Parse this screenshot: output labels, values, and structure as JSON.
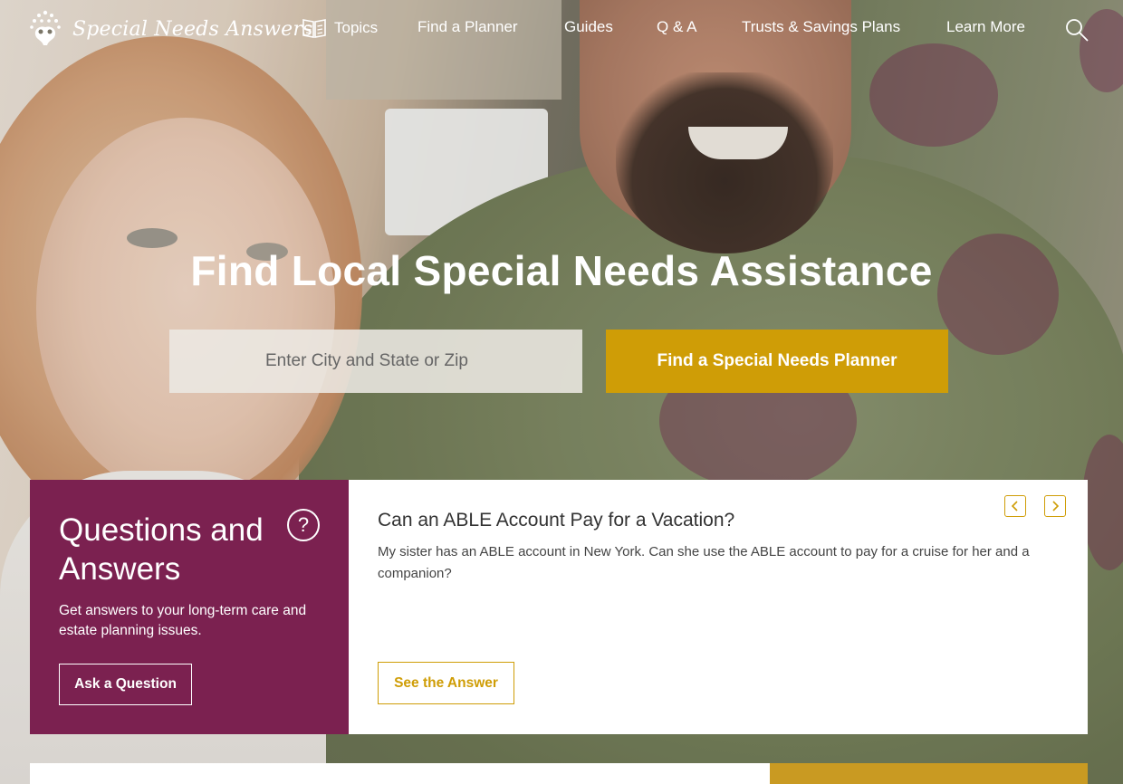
{
  "site": {
    "name": "Special Needs Answers"
  },
  "nav": {
    "items": [
      {
        "label": "Topics",
        "icon": "book-icon"
      },
      {
        "label": "Find a Planner"
      },
      {
        "label": "Guides"
      },
      {
        "label": "Q & A"
      },
      {
        "label": "Trusts & Savings Plans"
      },
      {
        "label": "Learn More"
      }
    ],
    "search_icon": "search-icon"
  },
  "hero": {
    "title": "Find Local Special Needs Assistance",
    "search_placeholder": "Enter City and State or Zip",
    "search_value": "",
    "find_button": "Find a Special Needs Planner"
  },
  "qa": {
    "heading": "Questions and Answers",
    "help_icon": "?",
    "description": "Get answers to your long-term care and estate planning issues.",
    "ask_button": "Ask a Question",
    "question": {
      "title": "Can an ABLE Account Pay for a Vacation?",
      "body": "My sister has an ABLE account in New York. Can she use the ABLE account to pay for a cruise for her and a companion?",
      "answer_button": "See the Answer"
    },
    "carousel": {
      "prev_icon": "chevron-left-icon",
      "next_icon": "chevron-right-icon"
    }
  },
  "colors": {
    "purple": "#7b2150",
    "gold": "#cf9d06",
    "white": "#ffffff"
  }
}
